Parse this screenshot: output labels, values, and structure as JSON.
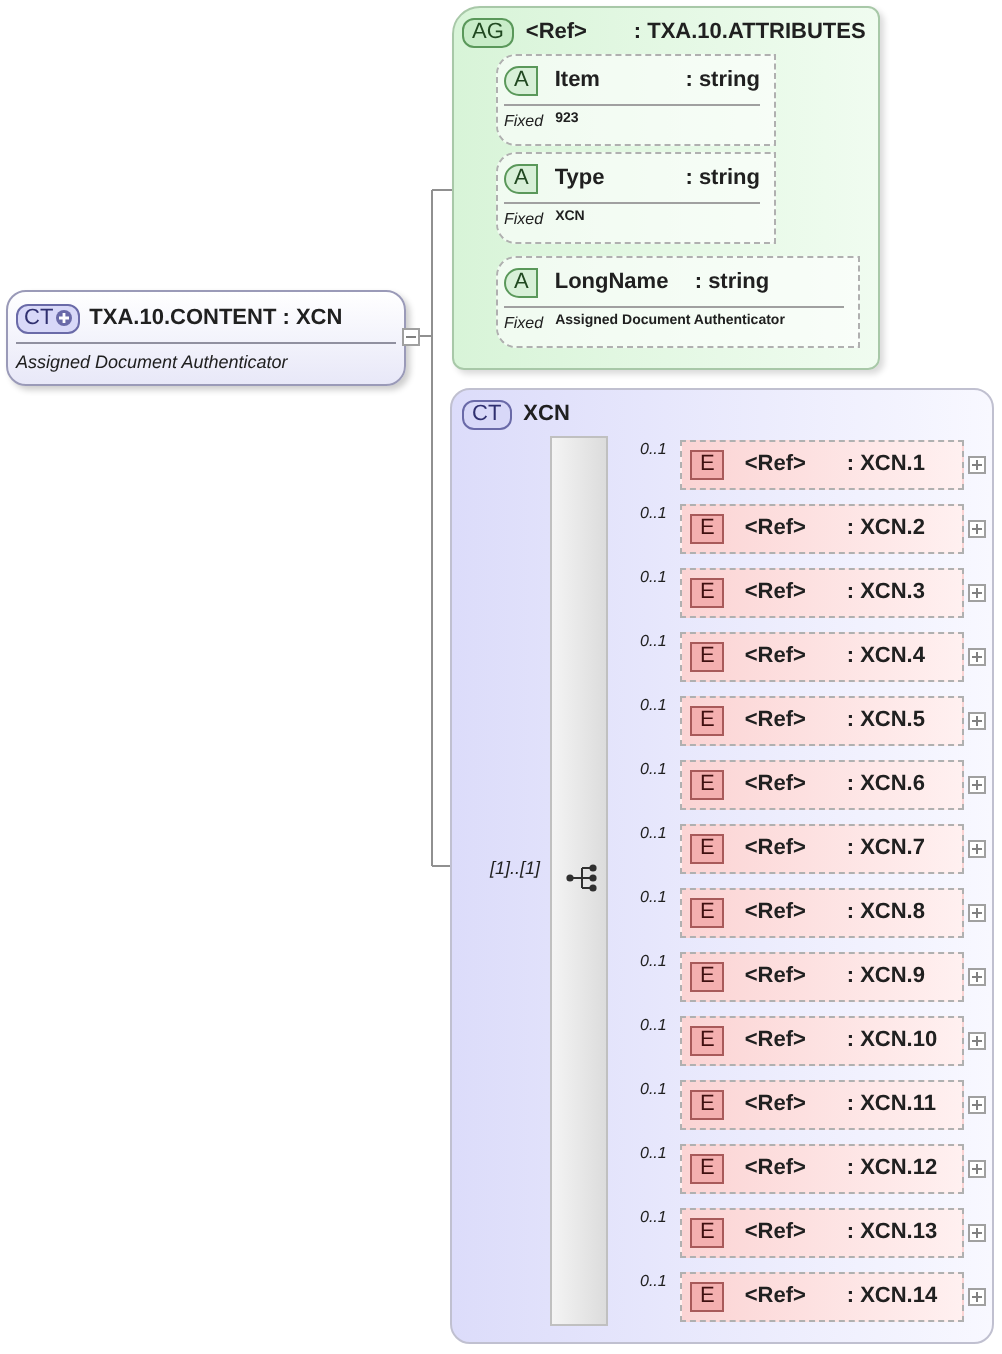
{
  "root": {
    "badge": "CT",
    "name": "TXA.10.CONTENT : XCN",
    "documentation": "Assigned Document Authenticator",
    "expanded": true
  },
  "attribute_group": {
    "badge": "AG",
    "ref": "<Ref>",
    "type": ": TXA.10.ATTRIBUTES",
    "attributes": [
      {
        "badge": "A",
        "name": "Item",
        "type": ": string",
        "fixed_label": "Fixed",
        "fixed_value": "923"
      },
      {
        "badge": "A",
        "name": "Type",
        "type": ": string",
        "fixed_label": "Fixed",
        "fixed_value": "XCN"
      },
      {
        "badge": "A",
        "name": "LongName",
        "type": ": string",
        "fixed_label": "Fixed",
        "fixed_value": "Assigned Document Authenticator"
      }
    ]
  },
  "complex_type": {
    "badge": "CT",
    "name": "XCN",
    "sequence_cardinality": "[1]..[1]",
    "elements": [
      {
        "badge": "E",
        "ref": "<Ref>",
        "type": ": XCN.1",
        "occurrence": "0..1",
        "expanded": false
      },
      {
        "badge": "E",
        "ref": "<Ref>",
        "type": ": XCN.2",
        "occurrence": "0..1",
        "expanded": false
      },
      {
        "badge": "E",
        "ref": "<Ref>",
        "type": ": XCN.3",
        "occurrence": "0..1",
        "expanded": false
      },
      {
        "badge": "E",
        "ref": "<Ref>",
        "type": ": XCN.4",
        "occurrence": "0..1",
        "expanded": false
      },
      {
        "badge": "E",
        "ref": "<Ref>",
        "type": ": XCN.5",
        "occurrence": "0..1",
        "expanded": false
      },
      {
        "badge": "E",
        "ref": "<Ref>",
        "type": ": XCN.6",
        "occurrence": "0..1",
        "expanded": false
      },
      {
        "badge": "E",
        "ref": "<Ref>",
        "type": ": XCN.7",
        "occurrence": "0..1",
        "expanded": false
      },
      {
        "badge": "E",
        "ref": "<Ref>",
        "type": ": XCN.8",
        "occurrence": "0..1",
        "expanded": false
      },
      {
        "badge": "E",
        "ref": "<Ref>",
        "type": ": XCN.9",
        "occurrence": "0..1",
        "expanded": false
      },
      {
        "badge": "E",
        "ref": "<Ref>",
        "type": ": XCN.10",
        "occurrence": "0..1",
        "expanded": false
      },
      {
        "badge": "E",
        "ref": "<Ref>",
        "type": ": XCN.11",
        "occurrence": "0..1",
        "expanded": false
      },
      {
        "badge": "E",
        "ref": "<Ref>",
        "type": ": XCN.12",
        "occurrence": "0..1",
        "expanded": false
      },
      {
        "badge": "E",
        "ref": "<Ref>",
        "type": ": XCN.13",
        "occurrence": "0..1",
        "expanded": false
      },
      {
        "badge": "E",
        "ref": "<Ref>",
        "type": ": XCN.14",
        "occurrence": "0..1",
        "expanded": false
      }
    ]
  }
}
